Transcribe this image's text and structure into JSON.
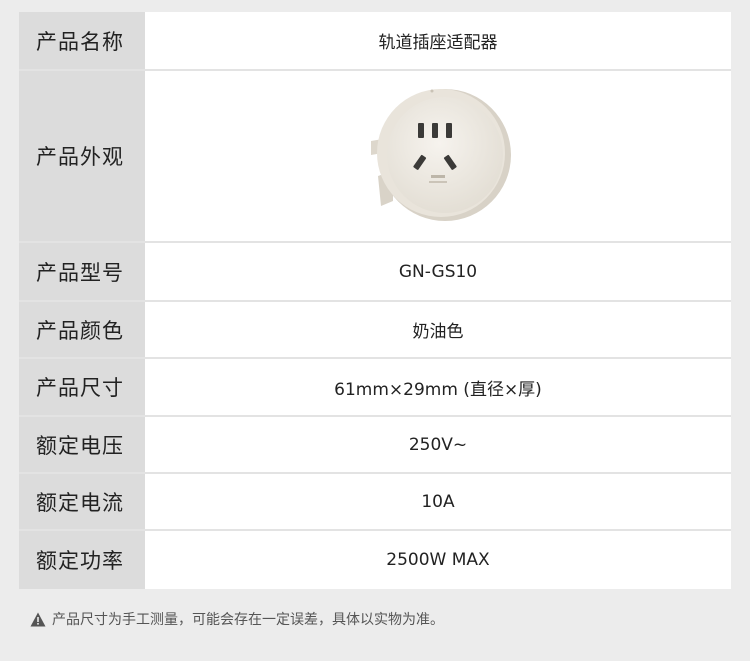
{
  "specs": [
    {
      "label": "产品名称",
      "value": "轨道插座适配器"
    },
    {
      "label": "产品外观",
      "value": ""
    },
    {
      "label": "产品型号",
      "value": "GN-GS10"
    },
    {
      "label": "产品颜色",
      "value": "奶油色"
    },
    {
      "label": "产品尺寸",
      "value": "61mm×29mm (直径×厚)"
    },
    {
      "label": "额定电压",
      "value": "250V~"
    },
    {
      "label": "额定电流",
      "value": "10A"
    },
    {
      "label": "额定功率",
      "value": "2500W MAX"
    }
  ],
  "product_image": {
    "icon": "socket-adapter-image",
    "color": "#ece7de"
  },
  "footnote": {
    "icon": "warning-icon",
    "text": "产品尺寸为手工测量，可能会存在一定误差，具体以实物为准。"
  }
}
